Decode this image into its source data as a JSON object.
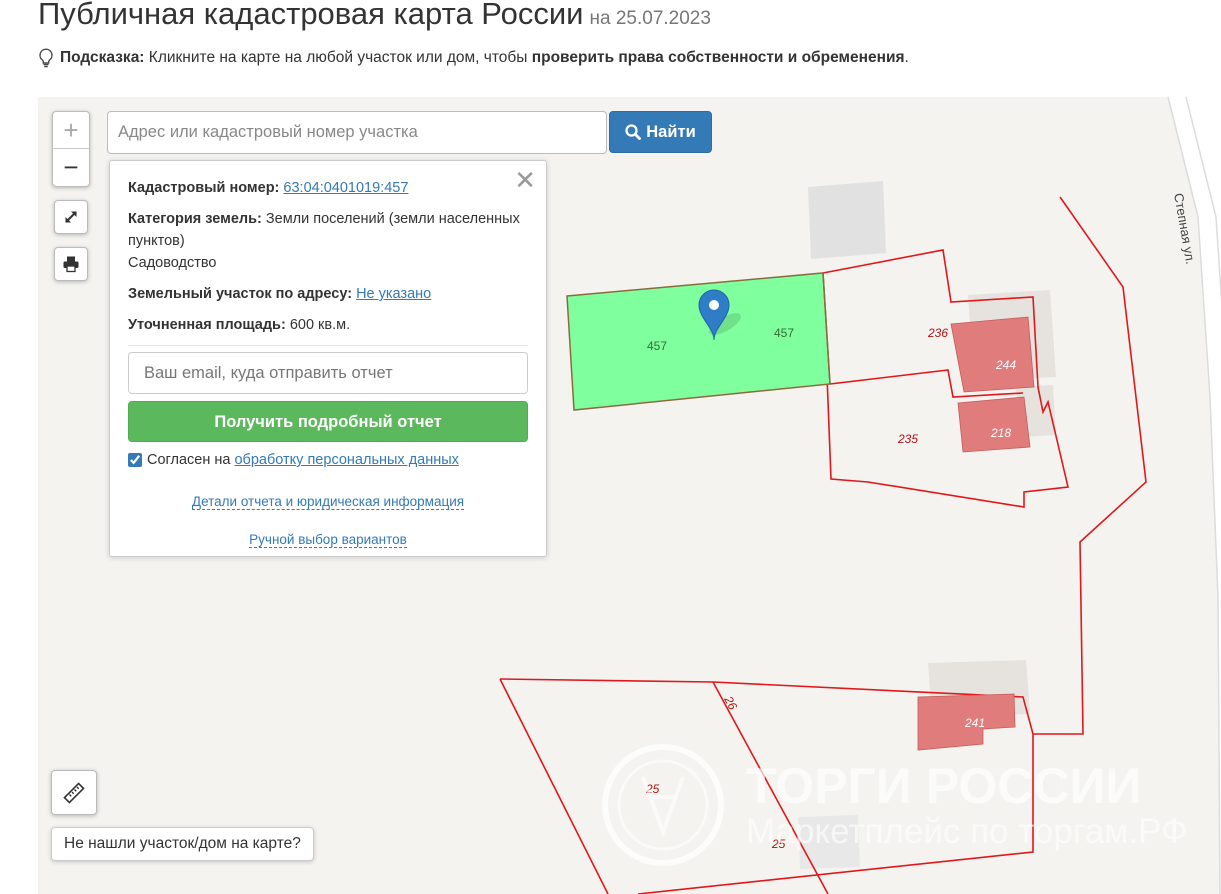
{
  "header": {
    "title": "Публичная кадастровая карта России",
    "date": "на 25.07.2023"
  },
  "hint": {
    "label": "Подсказка:",
    "text": " Кликните на карте на любой участок или дом, чтобы ",
    "bold_text": "проверить права собственности и обременения",
    "end": "."
  },
  "controls": {
    "zoom_in": "+",
    "zoom_out": "−",
    "icons": [
      "lightbulb-icon",
      "fullscreen-icon",
      "print-icon",
      "ruler-icon",
      "search-icon",
      "close-icon",
      "map-pin-icon"
    ]
  },
  "search": {
    "placeholder": "Адрес или кадастровый номер участка",
    "button": "Найти"
  },
  "popup": {
    "close": "✕",
    "cadastral_label": "Кадастровый номер:",
    "cadastral_value": "63:04:0401019:457",
    "category_label": "Категория земель:",
    "category_value": "Земли поселений (земли населенных пунктов)",
    "category_sub": "Садоводство",
    "address_label": "Земельный участок по адресу:",
    "address_value": "Не указано",
    "area_label": "Уточненная площадь:",
    "area_value": "600 кв.м.",
    "email_placeholder": "Ваш email, куда отправить отчет",
    "report_button": "Получить подробный отчет",
    "agree_text": "Согласен на ",
    "agree_link": "обработку персональных данных",
    "details_link": "Детали отчета и юридическая информация",
    "manual_link": "Ручной выбор вариантов"
  },
  "map": {
    "street": "Степная ул.",
    "plot_selected_left": "457",
    "plot_selected_right": "457",
    "plots": [
      "236",
      "235",
      "26",
      "25",
      "25"
    ],
    "buildings": [
      "244",
      "218",
      "241"
    ],
    "watermark_title": "ТОРГИ РОССИИ",
    "watermark_sub": "Маркетплейс по торгам.РФ",
    "colors": {
      "selected": "#80ff9e",
      "boundary": "#e0181c",
      "building": "#e07c7c"
    }
  },
  "bottom": {
    "not_found": "Не нашли участок/дом на карте?"
  }
}
